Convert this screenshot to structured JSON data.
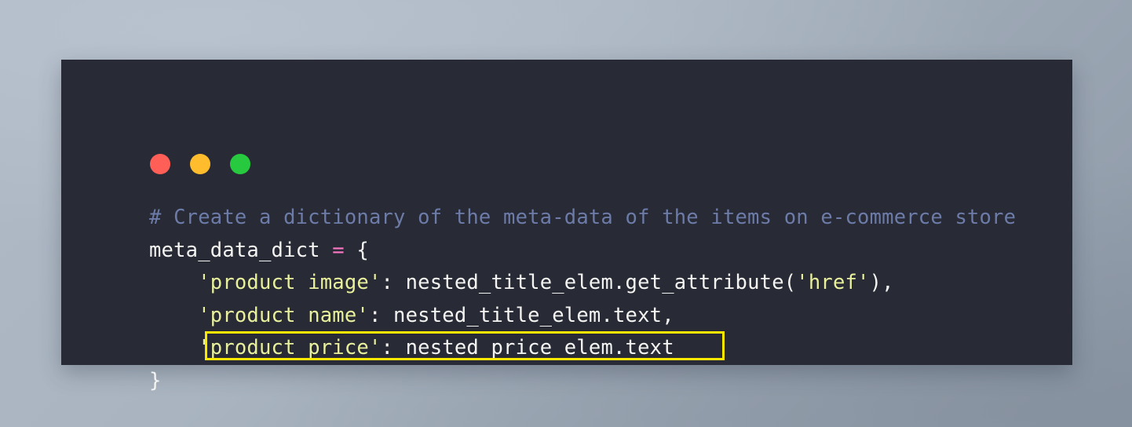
{
  "background": {
    "gradient_from": "#B0BAC6",
    "gradient_to": "#8E99A7"
  },
  "card": {
    "background": "#282B36",
    "title_bar": {
      "dots": [
        {
          "name": "close",
          "color": "#FF5F56"
        },
        {
          "name": "minimize",
          "color": "#FFBD2E"
        },
        {
          "name": "maximize",
          "color": "#27C93F"
        }
      ]
    }
  },
  "highlight": {
    "border_color": "#FFE800",
    "target_line_index": 4,
    "target_text": "'product price': nested_price_elem.text"
  },
  "syntax_colors": {
    "comment": "#6C7BA8",
    "string": "#E8F09C",
    "operator": "#FF79C6",
    "plain": "#F4F4F2"
  },
  "code": {
    "language": "python",
    "full_text": "# Create a dictionary of the meta-data of the items on e-commerce store\nmeta_data_dict = {\n    'product image': nested_title_elem.get_attribute('href'),\n    'product name': nested_title_elem.text,\n    'product price': nested_price_elem.text\n}",
    "lines": [
      {
        "index": 1,
        "tokens": [
          {
            "t": "comment",
            "v": "# Create a dictionary of the meta-data of the items on e-commerce store"
          }
        ]
      },
      {
        "index": 2,
        "tokens": [
          {
            "t": "plain",
            "v": "meta_data_dict "
          },
          {
            "t": "op",
            "v": "="
          },
          {
            "t": "plain",
            "v": " {"
          }
        ]
      },
      {
        "index": 3,
        "tokens": [
          {
            "t": "plain",
            "v": "    "
          },
          {
            "t": "string",
            "v": "'product image'"
          },
          {
            "t": "plain",
            "v": ": nested_title_elem.get_attribute("
          },
          {
            "t": "string",
            "v": "'href'"
          },
          {
            "t": "plain",
            "v": "),"
          }
        ]
      },
      {
        "index": 4,
        "tokens": [
          {
            "t": "plain",
            "v": "    "
          },
          {
            "t": "string",
            "v": "'product name'"
          },
          {
            "t": "plain",
            "v": ": nested_title_elem.text,"
          }
        ]
      },
      {
        "index": 5,
        "tokens": [
          {
            "t": "plain",
            "v": "    "
          },
          {
            "t": "string",
            "v": "'product price'"
          },
          {
            "t": "plain",
            "v": ": nested_price_elem.text"
          }
        ]
      },
      {
        "index": 6,
        "tokens": [
          {
            "t": "plain",
            "v": "}"
          }
        ]
      }
    ]
  }
}
